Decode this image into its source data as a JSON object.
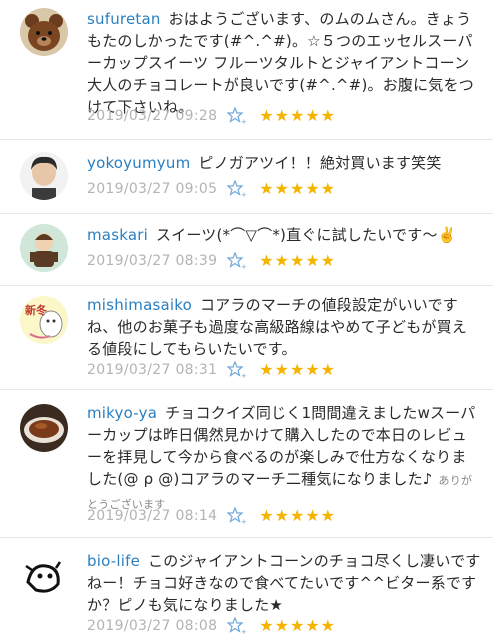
{
  "comments": [
    {
      "user": "sufuretan",
      "text": "おはようございます、のムのムさん。きょうもたのしかったです(#^.^#)。☆５つのエッセルスーパーカップスイーツ フルーツタルトとジャイアントコーン 大人のチョコレートが良いです(#^.^#)。お腹に気をつけて下さいね。",
      "date": "2019/03/27 09:28",
      "avatar_icon": "teddy-bear-avatar",
      "rating": 5
    },
    {
      "user": "yokoyumyum",
      "text": "ピノガアツイ！！絶対買います笑笑",
      "date": "2019/03/27 09:05",
      "avatar_icon": "person-photo-avatar",
      "rating": 5
    },
    {
      "user": "maskari",
      "text": "スイーツ(*⌒▽⌒*)直ぐに試したいです〜✌️",
      "date": "2019/03/27 08:39",
      "avatar_icon": "cartoon-character-avatar",
      "rating": 5
    },
    {
      "user": "mishimasaiko",
      "text": "コアラのマーチの値段設定がいいですね、他のお菓子も過度な高級路線はやめて子どもが買える値段にしてもらいたいです。",
      "date": "2019/03/27 08:31",
      "avatar_icon": "shinto-illustration-avatar",
      "avatar_text": "新冬",
      "rating": 5
    },
    {
      "user": "mikyo-ya",
      "text": "チョコクイズ同じく1問間違えましたwスーパーカップは昨日偶然見かけて購入したので本日のレビューを拝見して今から食べるのが楽しみで仕方なくなりました(@  ρ  @)コアラのマーチ二種気になりました♪",
      "note": "ありがとうございます",
      "date": "2019/03/27 08:14",
      "avatar_icon": "food-photo-avatar",
      "rating": 5
    },
    {
      "user": "bio-life",
      "text": "このジャイアントコーンのチョコ尽くし凄いですねー！チョコ好きなので食べてたいです^^ビター系ですか？ピノも気になりました★",
      "date": "2019/03/27 08:08",
      "avatar_icon": "ink-drawing-avatar",
      "rating": 5
    }
  ],
  "colors": {
    "username": "#2a7fc1",
    "date": "#b3b3b3",
    "star": "#f4b400",
    "star_outline": "#6fa8dc"
  }
}
